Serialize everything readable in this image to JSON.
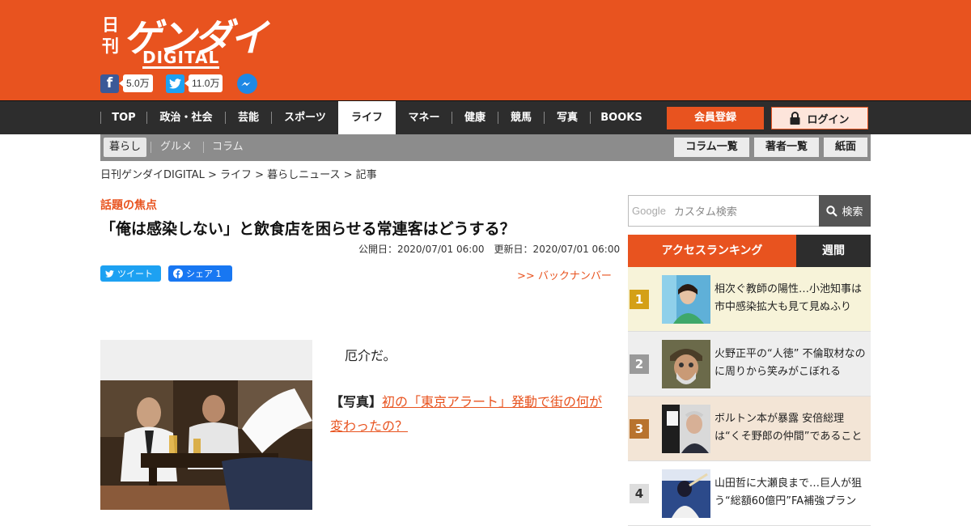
{
  "header": {
    "logo": {
      "nikkan": "日刊",
      "gendai": "ゲンダイ",
      "digital": "DIGITAL"
    },
    "share": {
      "facebook_count": "5.0万",
      "twitter_count": "11.0万"
    }
  },
  "nav": {
    "items": [
      "TOP",
      "政治・社会",
      "芸能",
      "スポーツ",
      "ライフ",
      "マネー",
      "健康",
      "競馬",
      "写真",
      "BOOKS"
    ],
    "active": "ライフ",
    "register_label": "会員登録",
    "login_label": "ログイン"
  },
  "subnav": {
    "items": [
      "暮らし",
      "グルメ",
      "コラム"
    ],
    "right": [
      "コラム一覧",
      "著者一覧",
      "紙面"
    ]
  },
  "breadcrumb": "日刊ゲンダイDIGITAL > ライフ > 暮らしニュース > 記事",
  "article": {
    "kicker": "話題の焦点",
    "title": "「俺は感染しない」と飲食店を困らせる常連客はどうする？",
    "dates": "公開日：2020/07/01 06:00　更新日：2020/07/01 06:00",
    "tweet_label": "ツイート",
    "fb_label": "シェア 1",
    "backnumber": ">> バックナンバー",
    "body_first": "厄介だ。",
    "photo_prefix": "【写真】",
    "photo_link": "初の「東京アラート」発動で街の何が変わったの？"
  },
  "sidebar": {
    "search_brand": "Google",
    "search_placeholder": "カスタム検索",
    "search_button": "検索",
    "tab_ranking": "アクセスランキング",
    "tab_weekly": "週間",
    "ranking": [
      {
        "num": "1",
        "text": "相次ぐ教師の陽性…小池知事は市中感染拡大も見て見ぬふり",
        "color": "#d4a017",
        "bg": "#f7f3d9"
      },
      {
        "num": "2",
        "text": "火野正平の“人徳” 不倫取材なのに周りから笑みがこぼれる",
        "color": "#9a9a9a",
        "bg": "#eeeeee"
      },
      {
        "num": "3",
        "text": "ボルトン本が暴露 安倍総理は“くそ野郎の仲間”であること",
        "color": "#b8732e",
        "bg": "#f3e5d6"
      },
      {
        "num": "4",
        "text": "山田哲に大瀬良まで…巨人が狙う“総額60億円”FA補強プラン",
        "color": "#333333",
        "bg": "#ffffff"
      }
    ]
  }
}
